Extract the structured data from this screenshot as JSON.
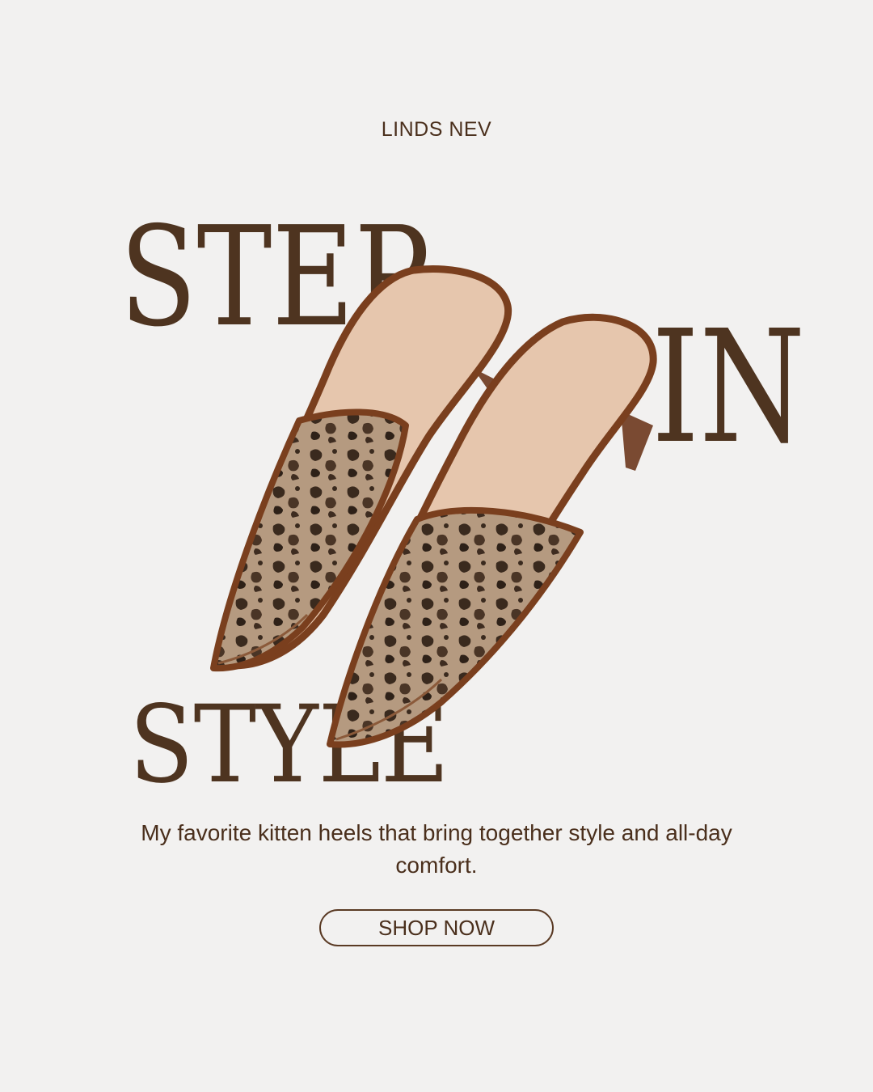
{
  "brand": "LINDS NEV",
  "headline": {
    "word1": "STEP",
    "word2": "IN",
    "word3": "STYLE"
  },
  "description": "My favorite kitten heels that bring together style and all-day comfort.",
  "cta_label": "SHOP NOW",
  "product_image": "leopard-print-kitten-heel-mules",
  "colors": {
    "background": "#f2f1f0",
    "text": "#4e3420",
    "trim": "#7a3f1e",
    "lining": "#e6c6ad"
  }
}
